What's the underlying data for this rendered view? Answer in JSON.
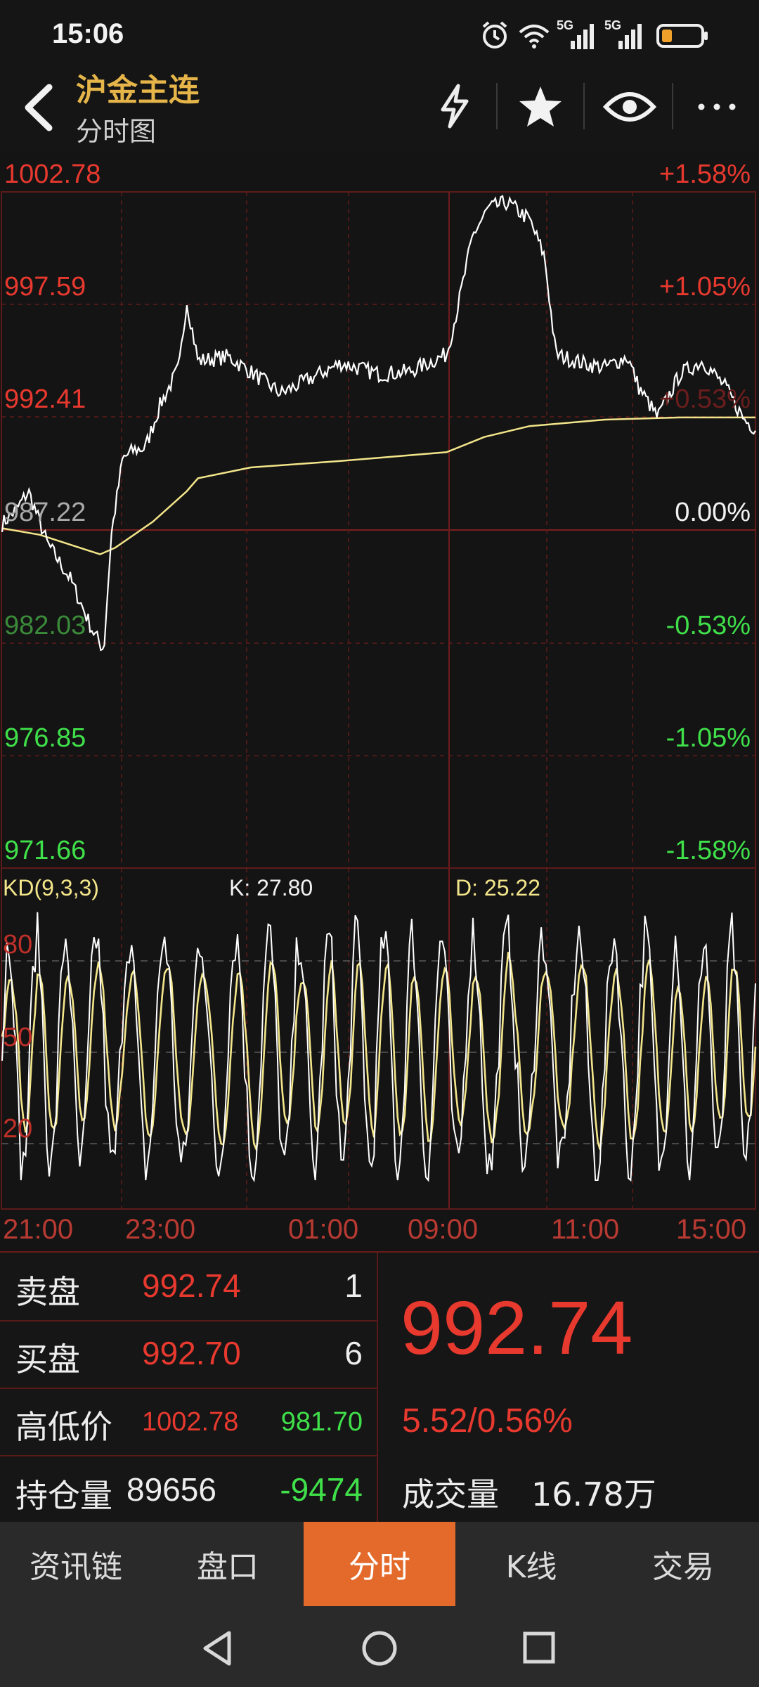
{
  "status_bar": {
    "time": "15:06",
    "signal_1": "5G",
    "signal_2": "5G"
  },
  "header": {
    "title": "沪金主连",
    "subtitle": "分时图",
    "icons": [
      "back-arrow-icon",
      "lightning-icon",
      "star-icon",
      "eye-icon",
      "more-icon"
    ]
  },
  "price_axis": {
    "labels": [
      "1002.78",
      "997.59",
      "992.41",
      "987.22",
      "982.03",
      "976.85",
      "971.66"
    ],
    "pct_labels": [
      "+1.58%",
      "+1.05%",
      "+0.53%",
      "0.00%",
      "-0.53%",
      "-1.05%",
      "-1.58%"
    ]
  },
  "indicator": {
    "name": "KD(9,3,3)",
    "k": "K: 27.80",
    "d": "D: 25.22",
    "levels": [
      "80",
      "50",
      "20"
    ]
  },
  "time_axis": [
    "21:00",
    "23:00",
    "01:00",
    "09:00",
    "11:00",
    "15:00"
  ],
  "quote": {
    "sell_label": "卖盘",
    "sell_price": "992.74",
    "sell_qty": "1",
    "buy_label": "买盘",
    "buy_price": "992.70",
    "buy_qty": "6",
    "hilo_label": "高低价",
    "high": "1002.78",
    "low": "981.70",
    "oi_label": "持仓量",
    "oi": "89656",
    "oi_change": "-9474",
    "last_price": "992.74",
    "change": "5.52/0.56%",
    "volume_label": "成交量",
    "volume": "16.78万"
  },
  "tabs": [
    {
      "label": "资讯链",
      "active": false
    },
    {
      "label": "盘口",
      "active": false
    },
    {
      "label": "分时",
      "active": true
    },
    {
      "label": "K线",
      "active": false
    },
    {
      "label": "交易",
      "active": false
    }
  ],
  "nav": [
    "back-nav-icon",
    "home-nav-icon",
    "recents-nav-icon"
  ],
  "colors": {
    "up": "#e8392f",
    "down": "#3fe04a",
    "accent": "#e36a2a",
    "avg_line": "#f3e58a",
    "price_line": "#ffffff"
  }
}
